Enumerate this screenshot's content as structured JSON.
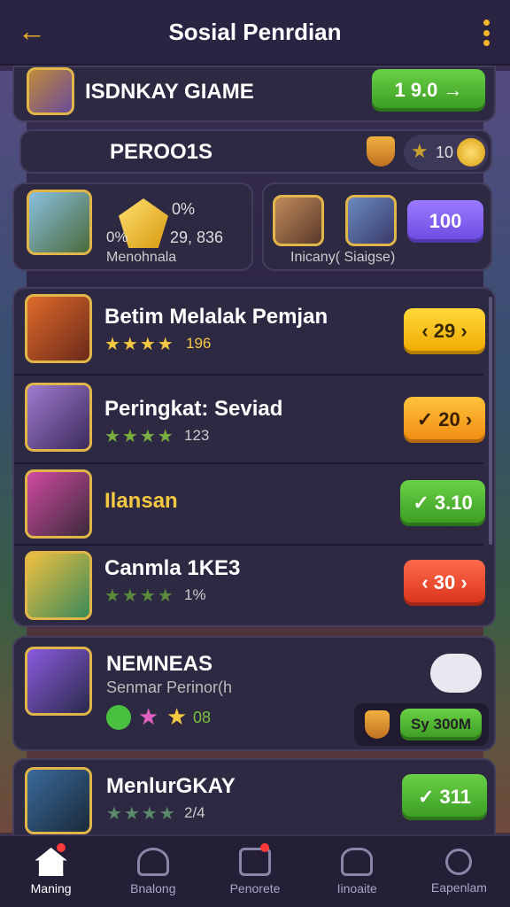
{
  "header": {
    "title": "Sosial Penrdian",
    "back_icon": "arrow-left-icon",
    "menu_icon": "kebab-menu-icon"
  },
  "banner": {
    "name": "ISDNKAY GIAME",
    "button": "1 9.0 →"
  },
  "stats": {
    "title": "PEROO1S",
    "coins": "10",
    "left_card": {
      "pct1": "0%",
      "pct2": "0%",
      "value": "29, 836",
      "label": "Menohnala"
    },
    "right_card": {
      "label": "Inicany( Siaigse)",
      "button": "100"
    }
  },
  "players": [
    {
      "name": "Betim Melalak Pemjan",
      "stars": "★★★★",
      "rating": "196",
      "button": "‹ 29 ›",
      "color": "yellow"
    },
    {
      "name": "Peringkat: Seviad",
      "stars": "★★★★",
      "rating": "123",
      "button": "✓ 20 ›",
      "color": "orange"
    },
    {
      "name": "Ilansan",
      "stars": "",
      "rating": "",
      "button": "✓ 3.10",
      "color": "green"
    },
    {
      "name": "Canmla 1KE3",
      "stars": "★★★★",
      "rating": "1%",
      "button": "‹ 30 ›",
      "color": "red"
    }
  ],
  "featured": {
    "name": "NEMNEAS",
    "sub": "Senmar Perinor(h",
    "score": "08",
    "button": "Sy 300M"
  },
  "last_player": {
    "name": "MenlurGKAY",
    "stars": "★★★★",
    "rating": "2/4",
    "button": "✓ 311"
  },
  "nav": [
    {
      "label": "Maning",
      "icon": "home-icon",
      "active": true
    },
    {
      "label": "Bnalong",
      "icon": "users-icon"
    },
    {
      "label": "Penorete",
      "icon": "calendar-icon"
    },
    {
      "label": "Iinoaite",
      "icon": "group-icon"
    },
    {
      "label": "Eapenlam",
      "icon": "search-icon"
    }
  ]
}
